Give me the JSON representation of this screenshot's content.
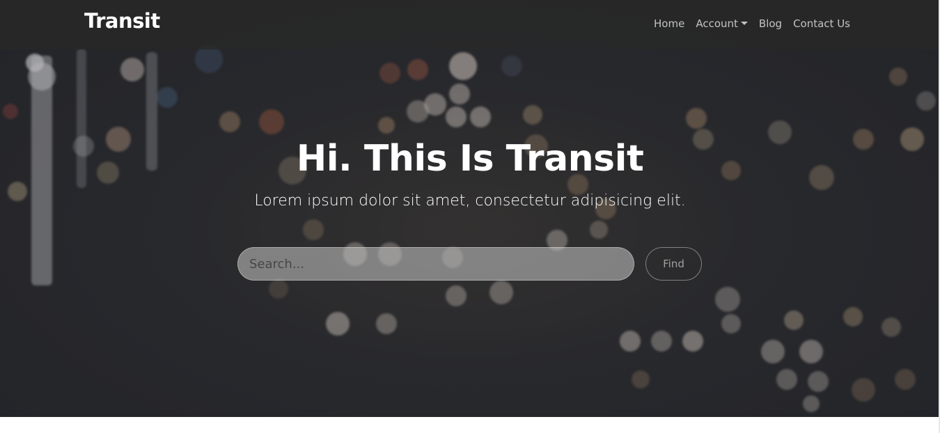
{
  "navbar": {
    "brand": "Transit",
    "items": [
      {
        "label": "Home",
        "has_dropdown": false
      },
      {
        "label": "Account",
        "has_dropdown": true
      },
      {
        "label": "Blog",
        "has_dropdown": false
      },
      {
        "label": "Contact Us",
        "has_dropdown": false
      }
    ]
  },
  "hero": {
    "title": "Hi. This Is Transit",
    "subtitle": "Lorem ipsum dolor sit amet, consectetur adipisicing elit.",
    "search": {
      "placeholder": "Search...",
      "value": ""
    },
    "find_label": "Find"
  },
  "colors": {
    "navbar_bg": "#282828",
    "hero_bg": "#2b2c30",
    "text": "#ffffff",
    "nav_text": "#bdbdbd"
  }
}
